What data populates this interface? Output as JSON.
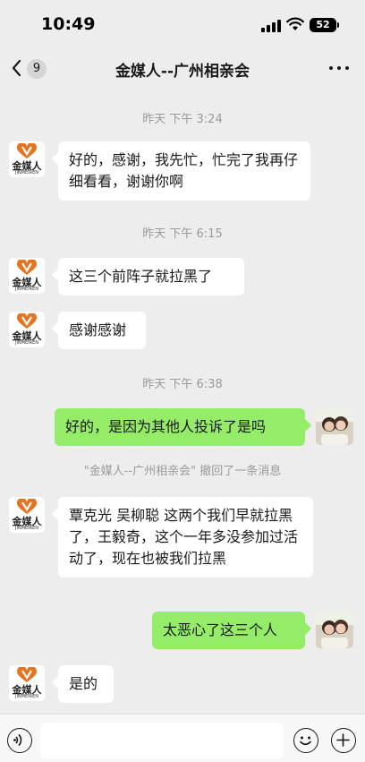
{
  "status": {
    "time": "10:49",
    "battery": "52"
  },
  "nav": {
    "unread_count": "9",
    "title": "金媒人--广州相亲会"
  },
  "avatar_logo": {
    "word": "金媒人",
    "sub": "JINMEIREN"
  },
  "messages": [
    {
      "timestamp": "昨天 下午 3:24"
    },
    {
      "text": "好的，感谢，我先忙，忙完了我再仔细看看，谢谢你啊"
    },
    {
      "timestamp": "昨天 下午 6:15"
    },
    {
      "text": "这三个前阵子就拉黑了"
    },
    {
      "text": "感谢感谢"
    },
    {
      "timestamp": "昨天 下午 6:38"
    },
    {
      "text": "好的，是因为其他人投诉了是吗"
    },
    {
      "recall": "\"金媒人--广州相亲会\" 撤回了一条消息"
    },
    {
      "text": "覃克光  吴柳聪   这两个我们早就拉黑了，王毅奇，这个一年多没参加过活动了，现在也被我们拉黑"
    },
    {
      "text": "太恶心了这三个人"
    },
    {
      "text": "是的"
    }
  ],
  "icons": {
    "back": "chevron-left-icon",
    "more": "more-dots-icon",
    "voice": "voice-icon",
    "emoji": "emoji-icon",
    "plus": "plus-icon"
  },
  "colors": {
    "background": "#ededed",
    "sent_bubble": "#95ec69",
    "received_bubble": "#ffffff",
    "logo_orange": "#e8731f"
  }
}
